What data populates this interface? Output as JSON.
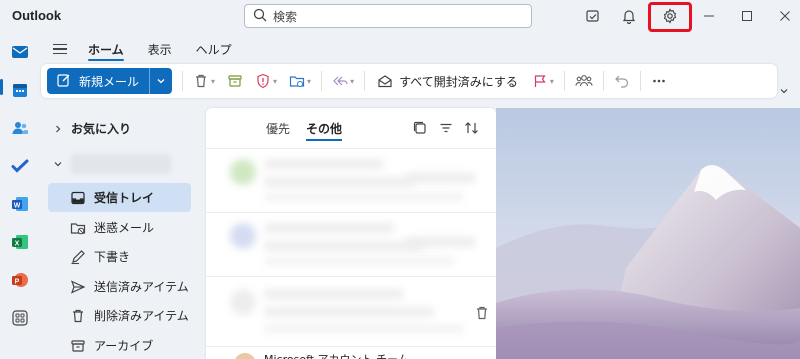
{
  "app": {
    "title": "Outlook"
  },
  "search": {
    "placeholder": "検索"
  },
  "titlebar_icons": [
    "my-day-icon",
    "bell-icon",
    "gear-icon",
    "minimize-icon",
    "maximize-icon",
    "close-icon"
  ],
  "ribbon": {
    "tabs": [
      "ホーム",
      "表示",
      "ヘルプ"
    ],
    "active_tab": "ホーム",
    "new_mail": "新規メール",
    "mark_all_read": "すべて開封済みにする"
  },
  "folders": {
    "favorites": "お気に入り",
    "items": [
      {
        "label": "受信トレイ",
        "icon": "inbox-icon",
        "active": true
      },
      {
        "label": "迷惑メール",
        "icon": "junk-icon",
        "active": false
      },
      {
        "label": "下書き",
        "icon": "draft-icon",
        "active": false
      },
      {
        "label": "送信済みアイテム",
        "icon": "send-icon",
        "active": false
      },
      {
        "label": "削除済みアイテム",
        "icon": "trash-icon",
        "active": false
      },
      {
        "label": "アーカイブ",
        "icon": "archive-icon",
        "active": false
      }
    ]
  },
  "message_list": {
    "tabs": [
      "優先",
      "その他"
    ],
    "active_tab": "その他",
    "last_visible_text": "Microsoft アカウント チーム"
  },
  "colors": {
    "accent": "#0f6cbd",
    "highlight_box": "#e81123",
    "active_folder_bg": "#cfe0f4"
  }
}
